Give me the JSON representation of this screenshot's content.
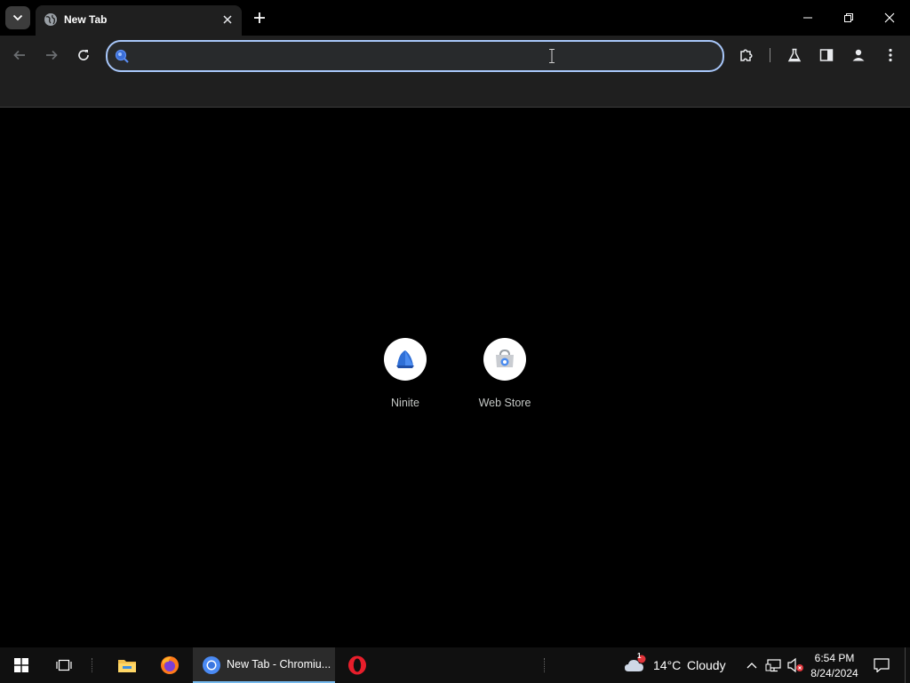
{
  "tab": {
    "title": "New Tab"
  },
  "omnibox": {
    "value": "",
    "placeholder": ""
  },
  "shortcuts": [
    {
      "label": "Ninite"
    },
    {
      "label": "Web Store"
    }
  ],
  "taskbar": {
    "active_window_label": "New Tab - Chromiu...",
    "weather": {
      "temp": "14°C",
      "condition": "Cloudy",
      "badge": "1"
    },
    "clock": {
      "time": "6:54 PM",
      "date": "8/24/2024"
    }
  },
  "colors": {
    "toolbar_bg": "#1f1f1f",
    "omnibox_border": "#a8c7fa",
    "page_bg": "#000000",
    "taskbar_bg": "#101010",
    "taskbar_active_underline": "#76b9ed"
  },
  "icons": [
    "tab-search-icon",
    "globe-icon",
    "close-icon",
    "plus-icon",
    "minimize-icon",
    "restore-icon",
    "back-icon",
    "forward-icon",
    "reload-icon",
    "search-icon",
    "puzzle-icon",
    "flask-icon",
    "side-panel-icon",
    "profile-icon",
    "kebab-menu-icon",
    "ninite-icon",
    "webstore-icon",
    "windows-start-icon",
    "task-view-icon",
    "file-explorer-icon",
    "firefox-icon",
    "chromium-icon",
    "opera-icon",
    "cloud-icon",
    "chevron-up-icon",
    "network-icon",
    "volume-muted-icon",
    "notification-icon"
  ]
}
